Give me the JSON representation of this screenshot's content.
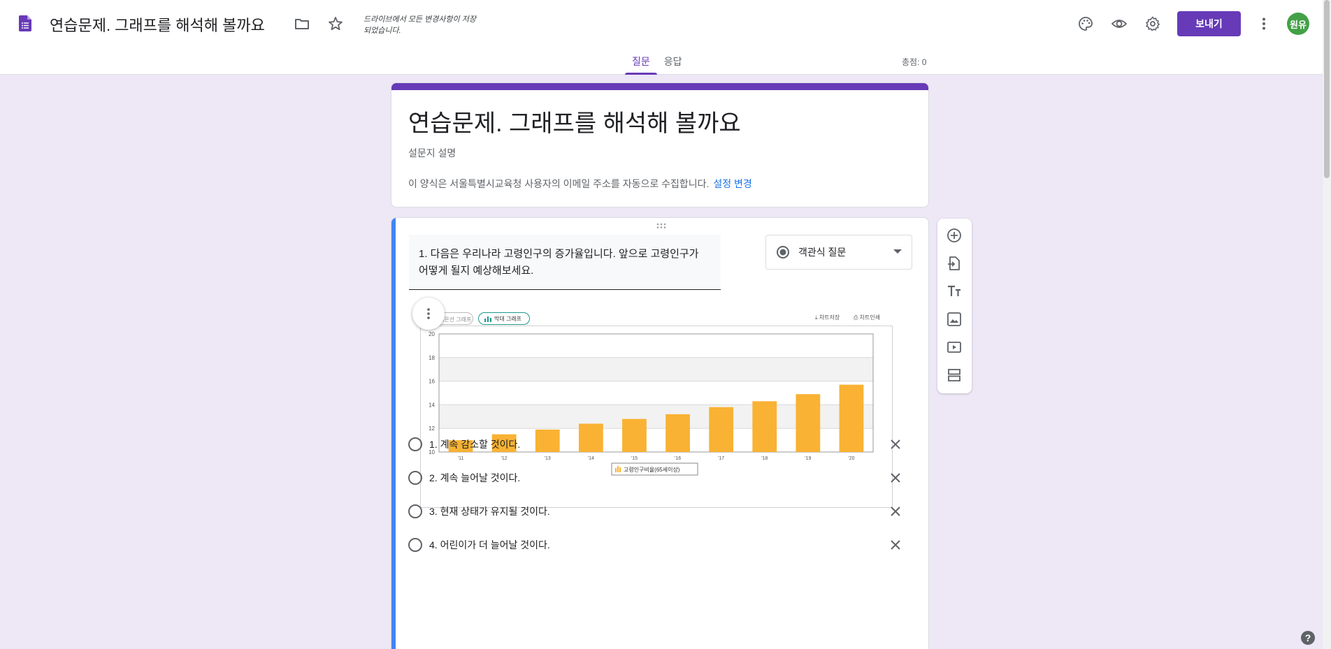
{
  "header": {
    "doc_title": "연습문제. 그래프를 해석해 볼까요",
    "save_status": "드라이브에서 모든 변경사항이 저장되었습니다.",
    "send_label": "보내기",
    "avatar_text": "원유",
    "tabs": [
      {
        "label": "질문",
        "active": true
      },
      {
        "label": "응답",
        "active": false
      }
    ],
    "total_points": "총점: 0"
  },
  "form": {
    "title": "연습문제. 그래프를 해석해 볼까요",
    "description_placeholder": "설문지 설명",
    "email_note": "이 양식은 서울특별시교육청 사용자의 이메일 주소를 자동으로 수집합니다.",
    "settings_link": "설정 변경"
  },
  "question": {
    "text": "1. 다음은 우리나라 고령인구의 증가율입니다. 앞으로 고령인구가 어떻게 될지 예상해보세요.",
    "type_label": "객관식 질문",
    "options": [
      {
        "label": "1. 계속 감소할 것이다."
      },
      {
        "label": "2. 계속 늘어날 것이다."
      },
      {
        "label": "3. 현재 상태가 유지될 것이다."
      },
      {
        "label": "4. 어린이가 더 늘어날 것이다."
      }
    ]
  },
  "chart_image": {
    "tab_line": "꺾은선 그래프",
    "tab_bar": "막대 그래프",
    "save_label": "차트저장",
    "print_label": "차트인쇄"
  },
  "chart_data": {
    "type": "bar",
    "categories": [
      "'11",
      "'12",
      "'13",
      "'14",
      "'15",
      "'16",
      "'17",
      "'18",
      "'19",
      "'20"
    ],
    "series": [
      {
        "name": "고령인구비율(65세이상)",
        "values": [
          11.0,
          11.5,
          11.9,
          12.4,
          12.8,
          13.2,
          13.8,
          14.3,
          14.9,
          15.7
        ],
        "color": "#f9b233"
      }
    ],
    "yticks": [
      10,
      12,
      14,
      16,
      18,
      20
    ],
    "ylim": [
      10,
      20
    ],
    "grid": true,
    "legend_placement": "bottom-center"
  },
  "colors": {
    "brand_purple": "#673ab7",
    "accent_blue": "#4285f4",
    "bar": "#f9b233",
    "link": "#1a73e8"
  }
}
